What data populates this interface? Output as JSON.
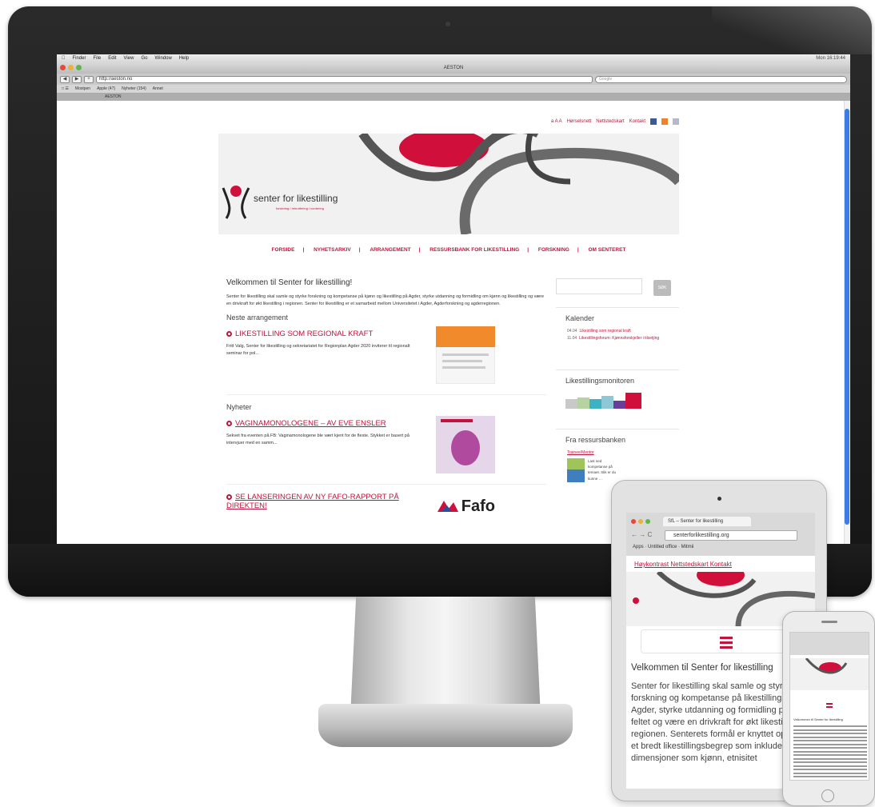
{
  "imac": {
    "menubar": {
      "items": [
        "Finder",
        "File",
        "Edit",
        "View",
        "Go",
        "Window",
        "Help"
      ],
      "clock": "Mon 16:19:44"
    },
    "window_title": "AESTON",
    "url": "http://aeston.no",
    "search_placeholder": "Google",
    "bookmarks": [
      "Mostpen",
      "Apple (47)",
      "Nyheter (154)",
      "Annet"
    ],
    "tab": "AESTON",
    "site": {
      "toplinks": [
        "Hørselsnett",
        "Nettstedskart",
        "Kontakt"
      ],
      "logo_text": "senter for likestilling",
      "logo_tagline": "forskning / rekruttering / vurdering",
      "nav": [
        "FORSIDE",
        "|",
        "NYHETSARKIV",
        "|",
        "ARRANGEMENT",
        "|",
        "RESSURSBANK FOR LIKESTILLING",
        "|",
        "FORSKNING",
        "|",
        "OM SENTERET"
      ],
      "welcome_title": "Velkommen til Senter for likestilling!",
      "welcome_text": "Senter for likestilling skal samle og styrke forskning og kompetanse på kjønn og likestilling på Agder, styrke utdanning og formidling om kjønn og likestilling og være en drivkraft for økt likestilling i regionen. Senter for likestilling er et samarbeid mellom Universitetet i Agder, Agderforskning og agderregionen.",
      "next_event_heading": "Neste arrangement",
      "event_title": "LIKESTILLING SOM REGIONAL KRAFT",
      "event_text": "Fritt Valg, Senter for likestilling og sekretariatet for Regionplan Agder 2020 inviterer til regionalt seminar for pol...",
      "news_heading": "Nyheter",
      "news1_title": "VAGINAMONOLOGENE – AV EVE ENSLER",
      "news1_text": "Sekvet fra eventen på FB: Vaginamonologene ble vært kjent for de fleste. Stykket er basert på intervjuer med en samm...",
      "news2_title": "SE LANSERINGEN AV NY FAFO-RAPPORT PÅ DIREKTEN!",
      "fafo_label": "Fafo",
      "search_button": "SØK",
      "calendar_title": "Kalender",
      "calendar_items": [
        {
          "date": "04.04",
          "label": "Likestilling som regional kraft"
        },
        {
          "date": "11.04",
          "label": "Likestillingsforum: Kjønnsforskjeller i tilsetjing"
        }
      ],
      "monitor_title": "Likestillingsmonitoren",
      "resource_title": "Fra ressursbanken",
      "resource_link": "Trainee/Mentor",
      "resource_text": "Last ned kompetanse på temaet. Slik er du kunne …"
    }
  },
  "ipad": {
    "tab_title": "SfL – Senter for likestilling",
    "url": "senterforlikestilling.org",
    "bookmarks": [
      "Apps",
      "Untitled office",
      "Mitmii"
    ],
    "toplinks": "Høykontrast  Nettstedskart  Kontakt",
    "welcome_title": "Velkommen til Senter for likestilling",
    "welcome_text": "Senter for likestilling skal samle og styrke forskning og kompetanse på likestilling på Agder, styrke utdanning og formidling på dette feltet og være en drivkraft for økt likestilling i regionen. Senterets formål er knyttet opp mot et bredt likestillingsbegrep som inkluderer dimensjoner som kjønn, etnisitet"
  },
  "iphone": {
    "welcome_title": "Velkommen til Senter for likestilling"
  },
  "colors": {
    "accent": "#c0143c",
    "mac_blue": "#3c7de5"
  }
}
